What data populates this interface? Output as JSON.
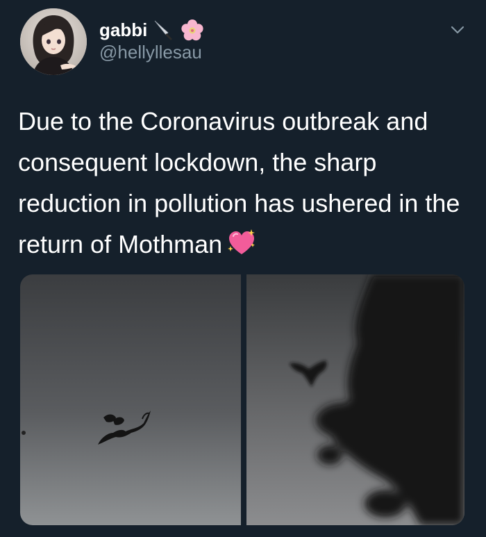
{
  "user": {
    "display_name": "gabbi",
    "handle": "@hellyllesau",
    "name_emojis": [
      "knife-emoji",
      "cherry-blossom-emoji"
    ],
    "avatar": "anime-girl-avatar"
  },
  "tweet": {
    "text": "Due to the Coronavirus outbreak and consequent lockdown, the sharp reduction in pollution has ushered in the return of Mothman",
    "trailing_emoji": "sparkling-heart-emoji"
  },
  "media": {
    "photos": [
      {
        "subject": "flying creature silhouette against grey sky"
      },
      {
        "subject": "winged silhouette near tree branches at night"
      }
    ]
  },
  "menu": {
    "icon": "chevron-down-icon"
  },
  "colors": {
    "background": "#15202b",
    "text_primary": "#ffffff",
    "text_secondary": "#8899a6"
  }
}
